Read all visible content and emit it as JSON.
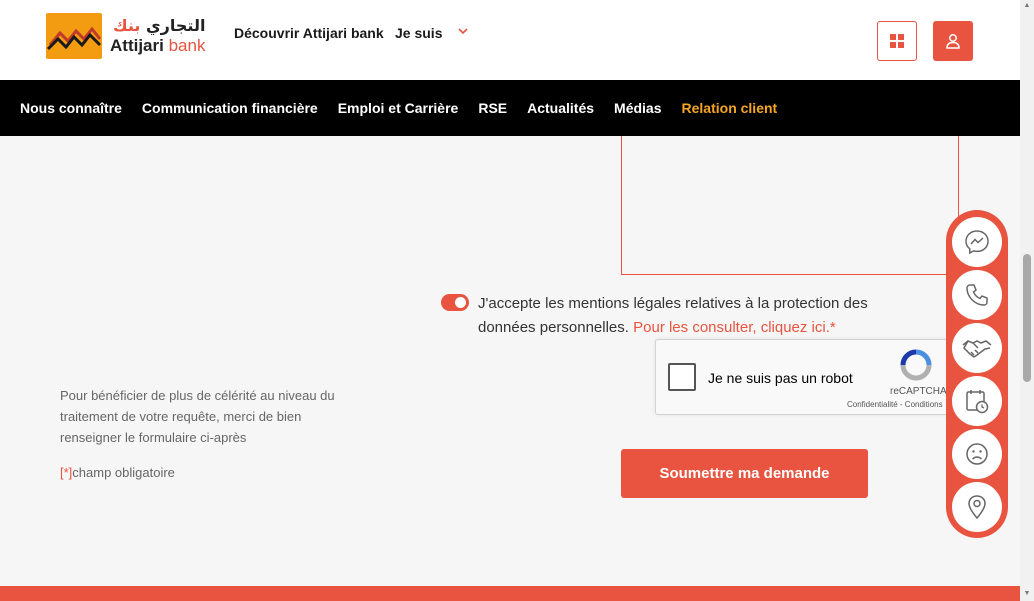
{
  "header": {
    "logo_arabic_1": "التجاري",
    "logo_arabic_2": "بنك",
    "logo_latin_1": "Attijari",
    "logo_latin_2": "bank",
    "discover_label": "Découvrir Attijari bank",
    "jesuis_label": "Je suis"
  },
  "nav": {
    "items": [
      "Nous connaître",
      "Communication financière",
      "Emploi et Carrière",
      "RSE",
      "Actualités",
      "Médias",
      "Relation client"
    ],
    "active_index": 6
  },
  "form": {
    "consent_text": "J'accepte les mentions légales relatives à la protection des données personnelles.",
    "consent_link": "Pour les consulter, cliquez ici.*",
    "consent_checked": true,
    "recaptcha_label": "Je ne suis pas un robot",
    "recaptcha_brand": "reCAPTCHA",
    "recaptcha_terms": "Confidentialité - Conditions",
    "submit_label": "Soumettre ma demande",
    "help_text": "Pour bénéficier de plus de célérité au niveau du traitement de votre requête, merci de bien renseigner le formulaire ci-après",
    "required_marker": "[*]",
    "required_text": "champ obligatoire"
  },
  "floating_bar": {
    "icons": [
      "messenger-icon",
      "phone-icon",
      "handshake-icon",
      "appointment-icon",
      "complaint-icon",
      "location-icon"
    ]
  },
  "colors": {
    "brand": "#e8543f",
    "nav_bg": "#000000",
    "nav_active": "#f6a623",
    "logo_orange": "#f39c12"
  }
}
